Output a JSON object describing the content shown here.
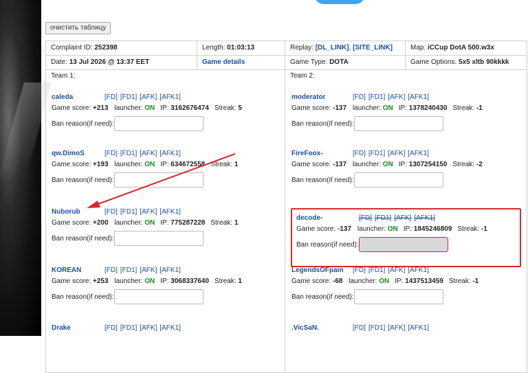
{
  "clear_button": "очистить таблицу",
  "header": {
    "complaint_id_label": "Complaint ID:",
    "complaint_id": "252398",
    "length_label": "Length:",
    "length": "01:03:13",
    "replay_label": "Replay:",
    "replay_dl": "[DL_LINK]",
    "replay_site": "[SITE_LINK]",
    "map_label": "Map:",
    "map": "iCCup DotA 500.w3x",
    "date_label": "Date:",
    "date": "13 Jul 2026 @ 13:37 EET",
    "game_details": "Game details",
    "game_type_label": "Game Type:",
    "game_type": "DOTA",
    "game_options_label": "Game Options:",
    "game_options": "5x5 xltb 90kkkk"
  },
  "labels": {
    "team1": "Team 1:",
    "team2": "Team 2:",
    "score": "Game score:",
    "launcher": "launcher:",
    "ip": "IP:",
    "streak": "Streak:",
    "ban_reason": "Ban reason(if need):",
    "fd": "[FD]",
    "fd1": "[FD1]",
    "afk": "[AFK]",
    "afk1": "[AFK1]"
  },
  "team1": [
    {
      "name": "caleda",
      "score": "+213",
      "launcher": "ON",
      "ip": "3162676474",
      "streak": "5"
    },
    {
      "name": "qw.DimoS",
      "score": "+193",
      "launcher": "ON",
      "ip": "634672558",
      "streak": "1"
    },
    {
      "name": "Nuborub",
      "score": "+200",
      "launcher": "ON",
      "ip": "775287228",
      "streak": "1"
    },
    {
      "name": "KOREAN",
      "score": "+253",
      "launcher": "ON",
      "ip": "3068337640",
      "streak": "1"
    },
    {
      "name": "Drake"
    }
  ],
  "team2": [
    {
      "name": "moderator",
      "score": "-137",
      "launcher": "ON",
      "ip": "1378240430",
      "streak": "-1"
    },
    {
      "name": "FireFoox-",
      "score": "-137",
      "launcher": "ON",
      "ip": "1307254150",
      "streak": "-2"
    },
    {
      "name": "decode-",
      "score": "-137",
      "launcher": "ON",
      "ip": "1845246809",
      "streak": "-1"
    },
    {
      "name": "LegendsOFpain",
      "score": "-68",
      "launcher": "ON",
      "ip": "1437513459",
      "streak": "-1"
    },
    {
      "name": ".VicSaN."
    }
  ],
  "colors": {
    "accent": "#3da5f0",
    "link": "#1a4fa3",
    "on": "#1a8a1a",
    "highlight": "#d9282b"
  }
}
